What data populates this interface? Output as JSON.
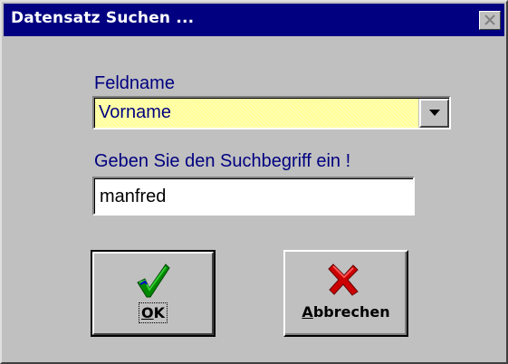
{
  "window": {
    "title": "Datensatz Suchen ...",
    "colors": {
      "titlebar": "#000080",
      "face": "#c0c0c0",
      "label": "#000080",
      "highlight": "#ffff99"
    }
  },
  "field_label": "Feldname",
  "field_select": {
    "value": "Vorname",
    "icon": "dropdown-arrow-icon"
  },
  "search_label": "Geben Sie den Suchbegriff ein !",
  "search_input": {
    "value": "manfred"
  },
  "buttons": {
    "ok": {
      "mnemonic": "O",
      "rest": "K",
      "icon": "green-checkmark-icon"
    },
    "cancel": {
      "mnemonic": "A",
      "rest": "bbrechen",
      "icon": "red-x-icon"
    }
  }
}
